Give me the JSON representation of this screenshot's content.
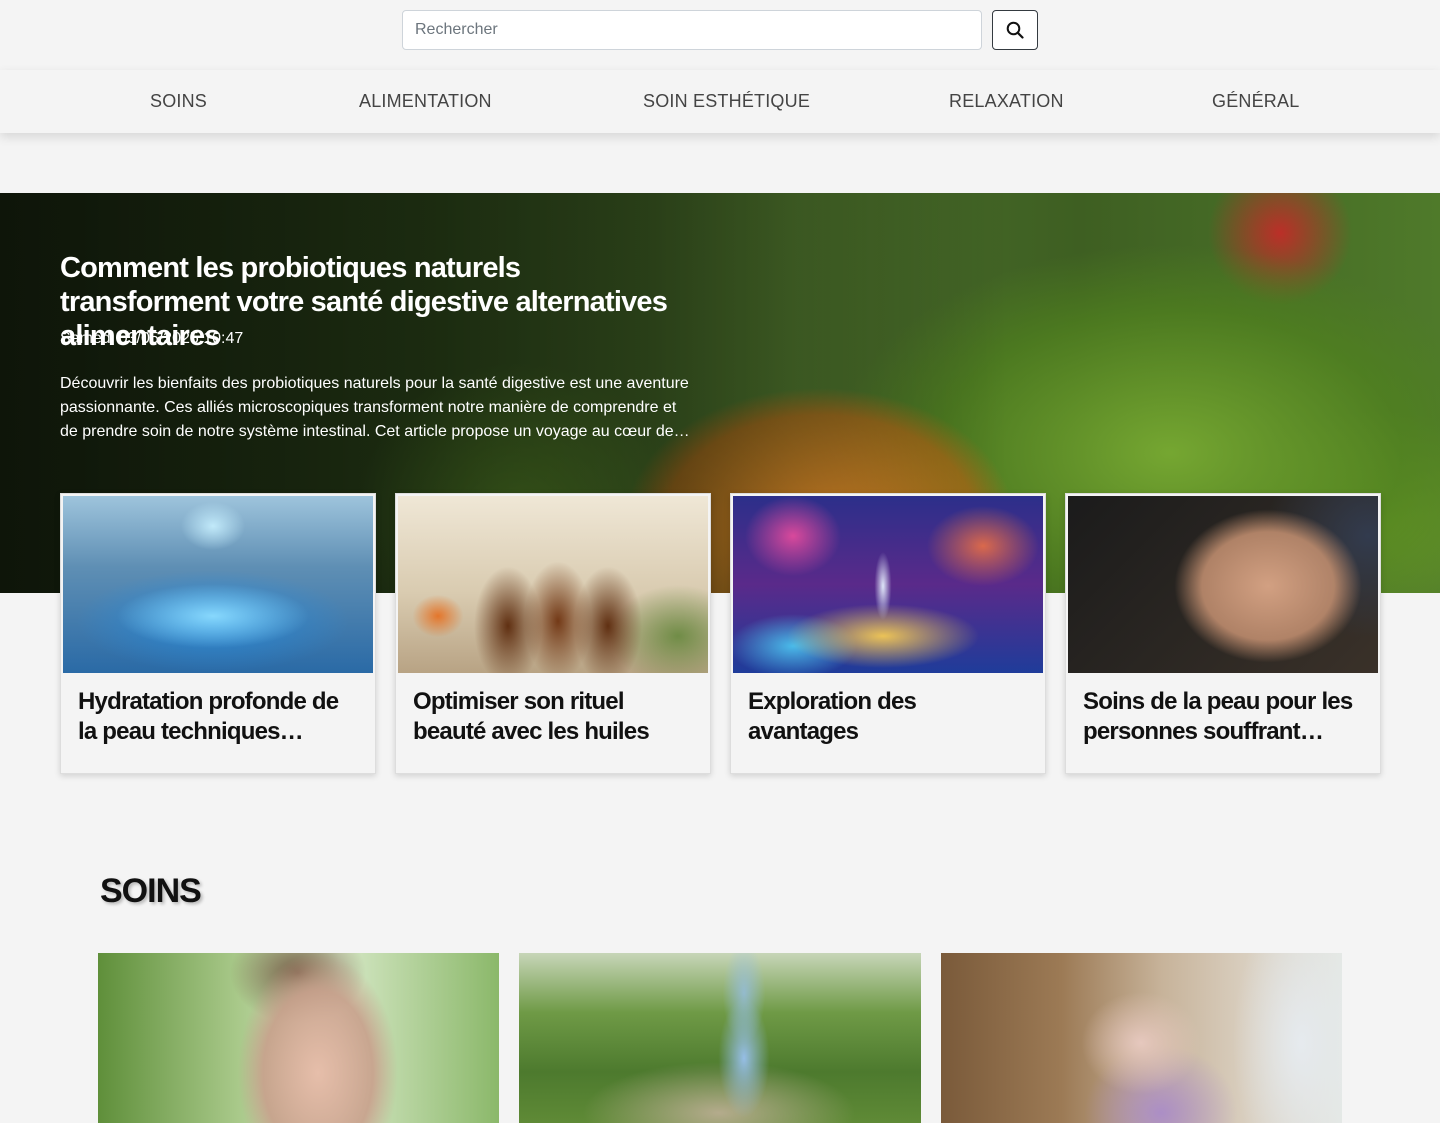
{
  "search": {
    "placeholder": "Rechercher",
    "button_icon": "search-icon"
  },
  "nav": {
    "items": [
      "SOINS",
      "ALIMENTATION",
      "SOIN ESTHÉTIQUE",
      "RELAXATION",
      "GÉNÉRAL"
    ]
  },
  "hero": {
    "title": "Comment les probiotiques naturels transforment votre santé digestive alternatives alimentaires",
    "date": "Samedi 03/05/2025 10:47",
    "excerpt": "Découvrir les bienfaits des probiotiques naturels pour la santé digestive est une aventure passionnante. Ces alliés microscopiques transforment notre manière de comprendre et de prendre soin de notre système intestinal. Cet article propose un voyage au cœur de…"
  },
  "featured": [
    {
      "title": "Hydratation profonde de la peau techniques…"
    },
    {
      "title": "Optimiser son rituel beauté avec les huiles essentielle…"
    },
    {
      "title": "Exploration des avantages psychologiques du bien-…"
    },
    {
      "title": "Soins de la peau pour les personnes souffrant…"
    }
  ],
  "section": {
    "title": "SOINS"
  },
  "colors": {
    "background": "#f4f4f4",
    "text": "#111111",
    "nav_text": "#444444"
  }
}
